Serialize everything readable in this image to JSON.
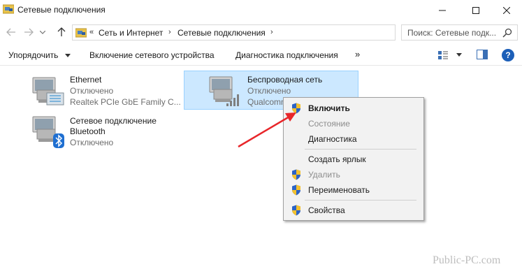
{
  "window": {
    "title": "Сетевые подключения",
    "controls": {
      "minimize": "minimize",
      "maximize": "maximize",
      "close": "close"
    }
  },
  "address": {
    "crumbs": [
      "Сеть и Интернет",
      "Сетевые подключения"
    ],
    "search_placeholder": "Поиск: Сетевые подк..."
  },
  "toolbar": {
    "organize_label": "Упорядочить",
    "enable_label": "Включение сетевого устройства",
    "diagnose_label": "Диагностика подключения",
    "more_label": "»",
    "help_label": "?"
  },
  "connections": [
    {
      "name": "Ethernet",
      "status": "Отключено",
      "device": "Realtek PCIe GbE Family C...",
      "icon": "ethernet-adapter-icon"
    },
    {
      "name": "Беспроводная сеть",
      "status": "Отключено",
      "device": "Qualcomm",
      "icon": "wireless-adapter-icon",
      "selected": true
    },
    {
      "name": "Сетевое подключение",
      "name2": "Bluetooth",
      "status": "Отключено",
      "icon": "bluetooth-adapter-icon"
    }
  ],
  "context_menu": {
    "items": [
      {
        "label": "Включить",
        "shield": true,
        "bold": true,
        "enabled": true
      },
      {
        "label": "Состояние",
        "shield": false,
        "enabled": false
      },
      {
        "label": "Диагностика",
        "shield": false,
        "enabled": true
      },
      {
        "label": "Создать ярлык",
        "shield": false,
        "enabled": true
      },
      {
        "label": "Удалить",
        "shield": true,
        "enabled": false
      },
      {
        "label": "Переименовать",
        "shield": true,
        "enabled": true
      },
      {
        "label": "Свойства",
        "shield": true,
        "enabled": true
      }
    ]
  },
  "watermark": "Public-PC.com",
  "colors": {
    "selection_bg": "#cce8ff",
    "selection_border": "#99d1ff",
    "arrow": "#e8262a",
    "help_blue": "#1c5fb8"
  }
}
